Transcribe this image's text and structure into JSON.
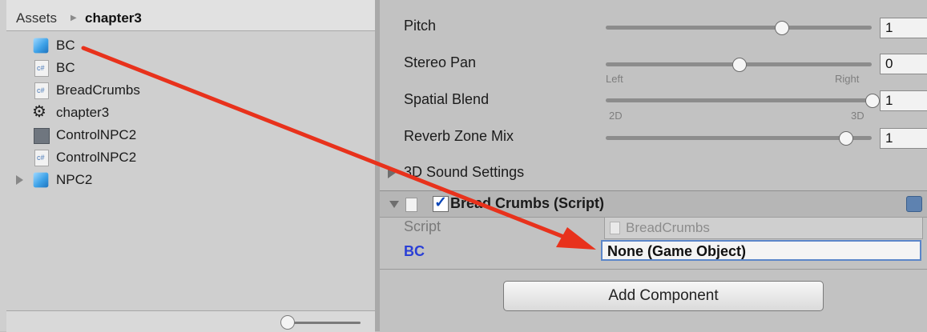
{
  "project": {
    "breadcrumb": [
      "Assets",
      "chapter3"
    ],
    "items": [
      {
        "label": "BC",
        "icon": "prefab-cube-icon"
      },
      {
        "label": "BC",
        "icon": "script-file-icon"
      },
      {
        "label": "BreadCrumbs",
        "icon": "script-file-icon"
      },
      {
        "label": "chapter3",
        "icon": "unity-scene-icon"
      },
      {
        "label": "ControlNPC2",
        "icon": "animator-controller-icon"
      },
      {
        "label": "ControlNPC2",
        "icon": "script-file-icon"
      },
      {
        "label": "NPC2",
        "icon": "prefab-cube-icon"
      }
    ],
    "zoom_level": 0.1
  },
  "inspector": {
    "properties": [
      {
        "label": "Pitch",
        "value": "1",
        "level": 0.66
      },
      {
        "label": "Stereo Pan",
        "value": "0",
        "level": 0.5,
        "min_label": "Left",
        "max_label": "Right"
      },
      {
        "label": "Spatial Blend",
        "value": "1",
        "level": 1.0,
        "min_label": "2D",
        "max_label": "3D"
      },
      {
        "label": "Reverb Zone Mix",
        "value": "1",
        "level": 0.9
      }
    ],
    "sound_settings_label": "3D Sound Settings",
    "component": {
      "title": "Bread Crumbs (Script)",
      "enabled": true,
      "script_label": "Script",
      "script_value": "BreadCrumbs",
      "field_label": "BC",
      "field_value": "None (Game Object)"
    },
    "add_component_label": "Add Component"
  },
  "colors": {
    "annotation_arrow": "#e8321c",
    "field_highlight": "#5b86c9",
    "bc_label": "#2a3fd6"
  }
}
